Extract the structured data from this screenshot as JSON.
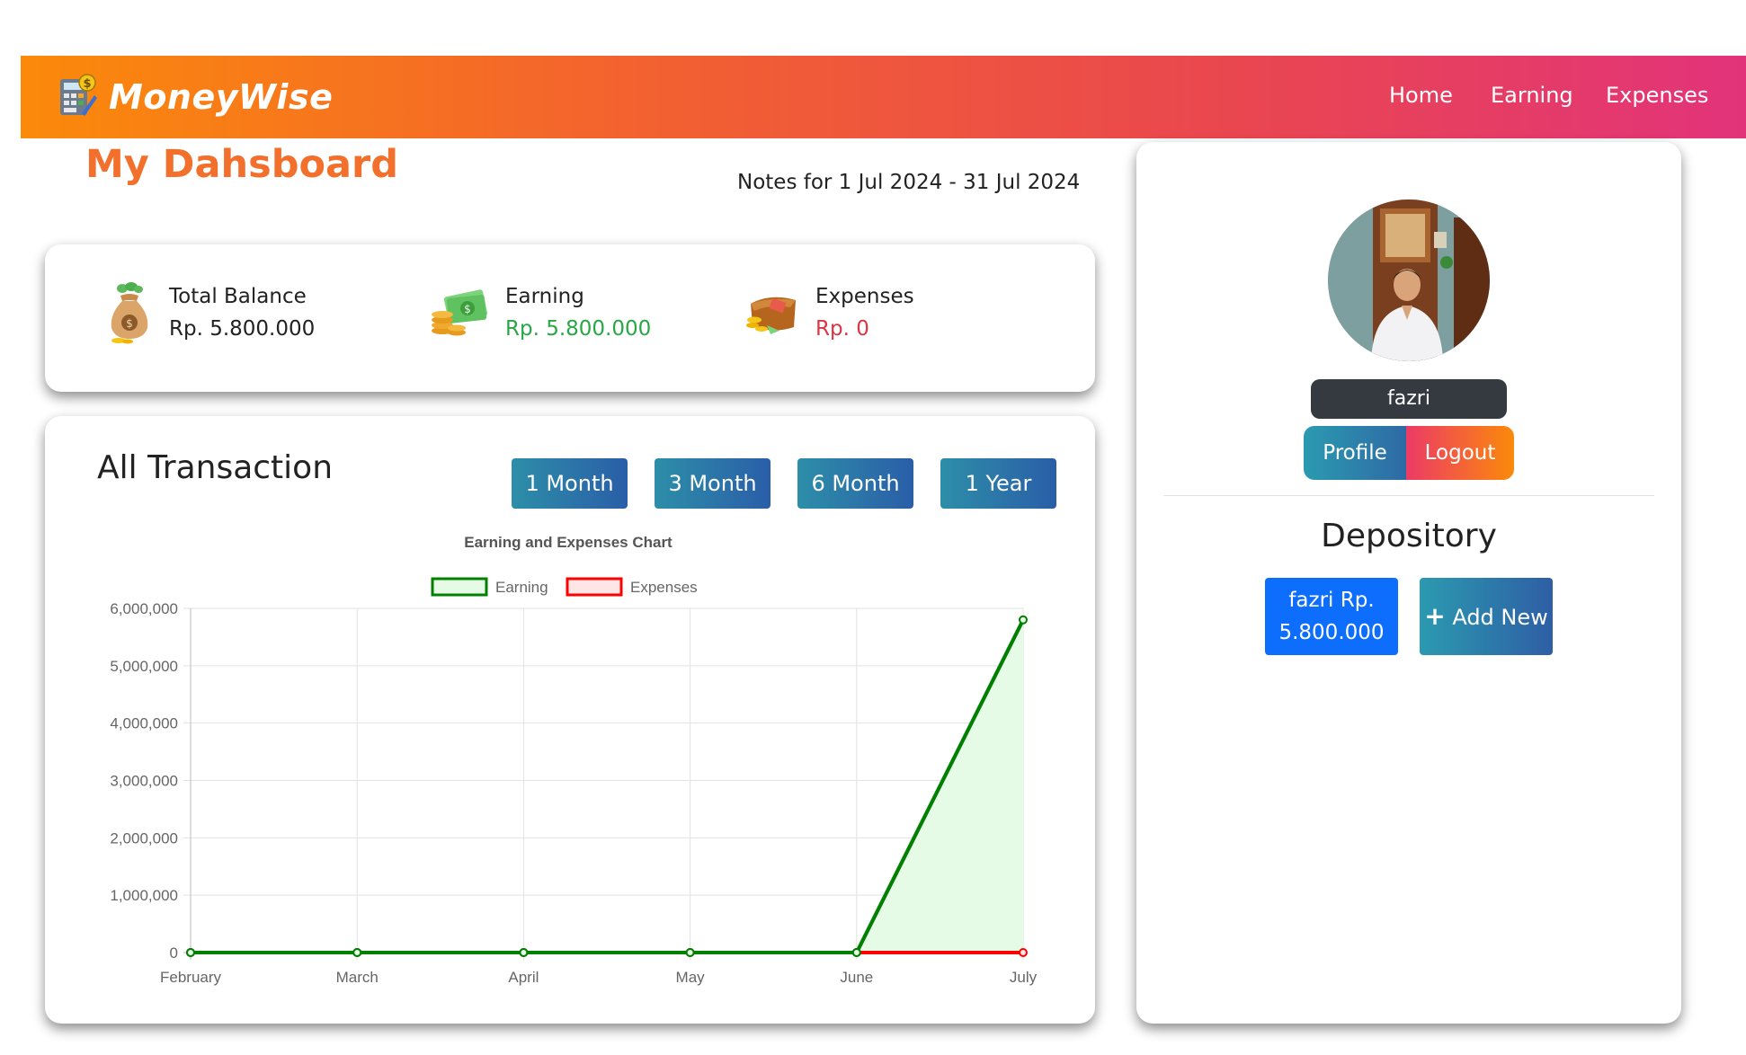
{
  "navbar": {
    "brand": "MoneyWise",
    "links": [
      "Home",
      "Earning",
      "Expenses"
    ]
  },
  "page": {
    "title": "My Dahsboard",
    "notes_range": "Notes for 1 Jul 2024 - 31 Jul 2024"
  },
  "summary": {
    "total_label": "Total Balance",
    "total_value": "Rp. 5.800.000",
    "earning_label": "Earning",
    "earning_value": "Rp. 5.800.000",
    "expenses_label": "Expenses",
    "expenses_value": "Rp. 0"
  },
  "transactions": {
    "title": "All Transaction",
    "ranges": [
      "1 Month",
      "3 Month",
      "6 Month",
      "1 Year"
    ]
  },
  "profile": {
    "username": "fazri",
    "profile_label": "Profile",
    "logout_label": "Logout"
  },
  "depository": {
    "title": "Depository",
    "items": [
      "fazri Rp. 5.800.000"
    ],
    "add_label": "Add New"
  },
  "colors": {
    "brand_orange": "#f26f2c",
    "earning": "#008000",
    "expenses": "#ff0000",
    "range_button": "#2d7aa8"
  },
  "chart_data": {
    "type": "line",
    "title": "Earning and Expenses Chart",
    "categories": [
      "February",
      "March",
      "April",
      "May",
      "June",
      "July"
    ],
    "series": [
      {
        "name": "Earning",
        "values": [
          0,
          0,
          0,
          0,
          0,
          5800000
        ],
        "color": "#008000",
        "fill": "#e6fbe6"
      },
      {
        "name": "Expenses",
        "values": [
          0,
          0,
          0,
          0,
          0,
          0
        ],
        "color": "#ff0000",
        "fill": "#ffe6e6"
      }
    ],
    "ylim": [
      0,
      6000000
    ],
    "yticks": [
      "0",
      "1,000,000",
      "2,000,000",
      "3,000,000",
      "4,000,000",
      "5,000,000",
      "6,000,000"
    ],
    "grid": true,
    "legend": "top"
  }
}
